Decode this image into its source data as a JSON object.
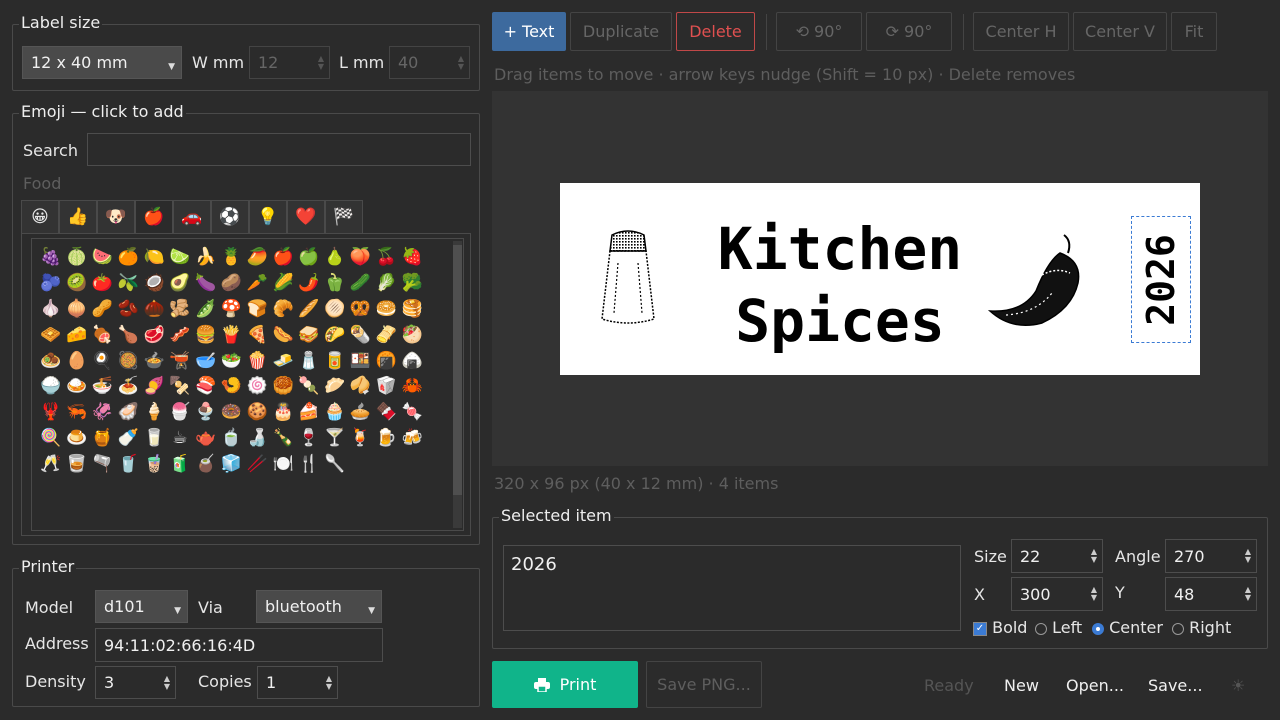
{
  "label_size": {
    "title": "Label size",
    "preset": "12 x 40 mm",
    "w_label": "W mm",
    "w_value": "12",
    "l_label": "L mm",
    "l_value": "40"
  },
  "emoji": {
    "title": "Emoji — click to add",
    "search_label": "Search",
    "search_value": "",
    "category_label": "Food",
    "tabs": [
      "😀",
      "👍",
      "🐶",
      "🍎",
      "🚗",
      "⚽",
      "💡",
      "❤️",
      "🏁"
    ],
    "grid": [
      "🍇",
      "🍈",
      "🍉",
      "🍊",
      "🍋",
      "🍋‍🟩",
      "🍌",
      "🍍",
      "🥭",
      "🍎",
      "🍏",
      "🍐",
      "🍑",
      "🍒",
      "🍓",
      "🫐",
      "🥝",
      "🍅",
      "🫒",
      "🥥",
      "🥑",
      "🍆",
      "🥔",
      "🥕",
      "🌽",
      "🌶️",
      "🫑",
      "🥒",
      "🥬",
      "🥦",
      "🧄",
      "🧅",
      "🥜",
      "🫘",
      "🌰",
      "🫚",
      "🫛",
      "🍄",
      "🍞",
      "🥐",
      "🥖",
      "🫓",
      "🥨",
      "🥯",
      "🥞",
      "🧇",
      "🧀",
      "🍖",
      "🍗",
      "🥩",
      "🥓",
      "🍔",
      "🍟",
      "🍕",
      "🌭",
      "🥪",
      "🌮",
      "🌯",
      "🫔",
      "🥙",
      "🧆",
      "🥚",
      "🍳",
      "🥘",
      "🍲",
      "🫕",
      "🥣",
      "🥗",
      "🍿",
      "🧈",
      "🧂",
      "🥫",
      "🍱",
      "🍘",
      "🍙",
      "🍚",
      "🍛",
      "🍜",
      "🍝",
      "🍠",
      "🍢",
      "🍣",
      "🍤",
      "🍥",
      "🥮",
      "🍡",
      "🥟",
      "🥠",
      "🥡",
      "🦀",
      "🦞",
      "🦐",
      "🦑",
      "🦪",
      "🍦",
      "🍧",
      "🍨",
      "🍩",
      "🍪",
      "🎂",
      "🍰",
      "🧁",
      "🥧",
      "🍫",
      "🍬",
      "🍭",
      "🍮",
      "🍯",
      "🍼",
      "🥛",
      "☕",
      "🫖",
      "🍵",
      "🍶",
      "🍾",
      "🍷",
      "🍸",
      "🍹",
      "🍺",
      "🍻",
      "🥂",
      "🥃",
      "🫗",
      "🥤",
      "🧋",
      "🧃",
      "🧉",
      "🧊",
      "🥢",
      "🍽️",
      "🍴",
      "🥄"
    ]
  },
  "printer": {
    "title": "Printer",
    "model_label": "Model",
    "model_value": "d101",
    "via_label": "Via",
    "via_value": "bluetooth",
    "address_label": "Address",
    "address_value": "94:11:02:66:16:4D",
    "density_label": "Density",
    "density_value": "3",
    "copies_label": "Copies",
    "copies_value": "1"
  },
  "toolbar": {
    "add_text": "+ Text",
    "duplicate": "Duplicate",
    "delete": "Delete",
    "rotate_left": "⟲ 90°",
    "rotate_right": "⟳ 90°",
    "center_h": "Center H",
    "center_v": "Center V",
    "fit": "Fit"
  },
  "hint": "Drag items to move · arrow keys nudge (Shift = 10 px) · Delete removes",
  "canvas": {
    "line1": "Kitchen",
    "line2": "Spices",
    "rotated_text": "2026",
    "salt_icon": "salt-shaker-icon",
    "pepper_icon": "chili-pepper-icon"
  },
  "canvas_info": "320 x 96 px (40 x 12 mm) · 4 items",
  "selected": {
    "title": "Selected item",
    "text": "2026",
    "size_label": "Size",
    "size_value": "22",
    "angle_label": "Angle",
    "angle_value": "270",
    "x_label": "X",
    "x_value": "300",
    "y_label": "Y",
    "y_value": "48",
    "bold_label": "Bold",
    "left_label": "Left",
    "center_label": "Center",
    "right_label": "Right"
  },
  "actions": {
    "print": "Print",
    "save_png": "Save PNG...",
    "status": "Ready",
    "new": "New",
    "open": "Open...",
    "save": "Save...",
    "theme_icon": "☀"
  },
  "colors": {
    "accent_blue": "#3d6a9e",
    "print_green": "#10b48a",
    "delete_red": "#e05050"
  }
}
